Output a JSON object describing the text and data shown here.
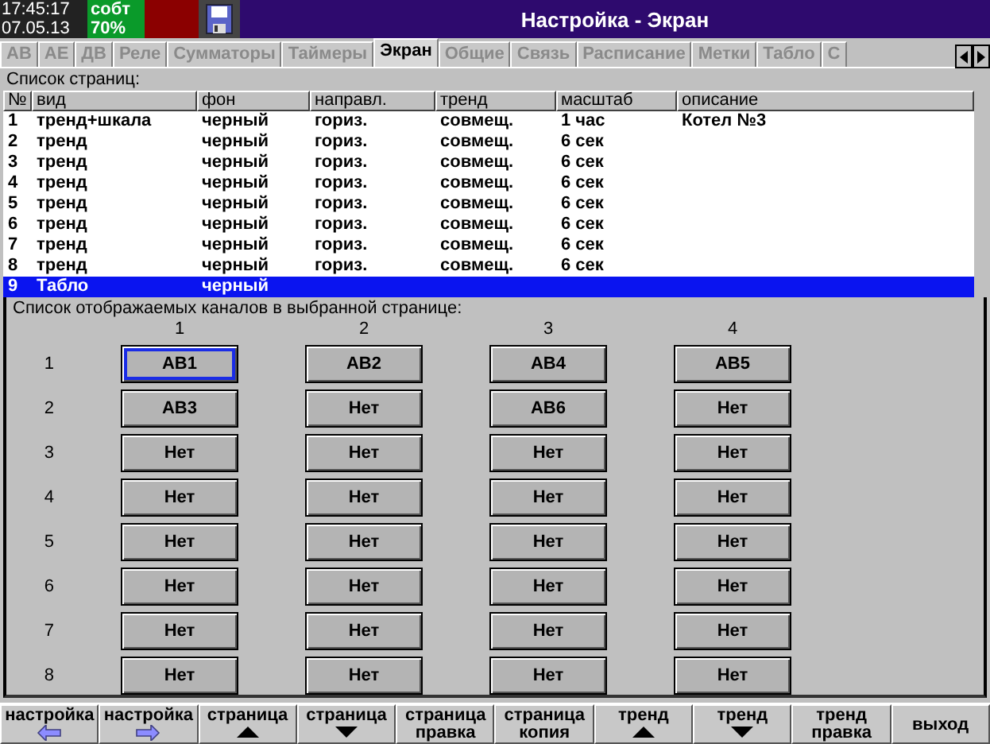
{
  "status": {
    "time": "17:45:17",
    "date": "07.05.13",
    "event": "собт",
    "percent": "70%"
  },
  "window": {
    "title": "Настройка - Экран"
  },
  "tabs": [
    {
      "label": "АВ",
      "selected": false
    },
    {
      "label": "АЕ",
      "selected": false
    },
    {
      "label": "ДВ",
      "selected": false
    },
    {
      "label": "Реле",
      "selected": false
    },
    {
      "label": "Сумматоры",
      "selected": false
    },
    {
      "label": "Таймеры",
      "selected": false
    },
    {
      "label": "Экран",
      "selected": true
    },
    {
      "label": "Общие",
      "selected": false
    },
    {
      "label": "Связь",
      "selected": false
    },
    {
      "label": "Расписание",
      "selected": false
    },
    {
      "label": "Метки",
      "selected": false
    },
    {
      "label": "Табло",
      "selected": false
    },
    {
      "label": "С",
      "selected": false
    }
  ],
  "pages": {
    "title": "Список страниц:",
    "columns": [
      "№",
      "вид",
      "фон",
      "направл.",
      "тренд",
      "масштаб",
      "описание"
    ],
    "rows": [
      {
        "cells": [
          "1",
          "тренд+шкала",
          "черный",
          "гориз.",
          "совмещ.",
          "1 час",
          "Котел №3"
        ],
        "selected": false
      },
      {
        "cells": [
          "2",
          "тренд",
          "черный",
          "гориз.",
          "совмещ.",
          "6 сек",
          ""
        ],
        "selected": false
      },
      {
        "cells": [
          "3",
          "тренд",
          "черный",
          "гориз.",
          "совмещ.",
          "6 сек",
          ""
        ],
        "selected": false
      },
      {
        "cells": [
          "4",
          "тренд",
          "черный",
          "гориз.",
          "совмещ.",
          "6 сек",
          ""
        ],
        "selected": false
      },
      {
        "cells": [
          "5",
          "тренд",
          "черный",
          "гориз.",
          "совмещ.",
          "6 сек",
          ""
        ],
        "selected": false
      },
      {
        "cells": [
          "6",
          "тренд",
          "черный",
          "гориз.",
          "совмещ.",
          "6 сек",
          ""
        ],
        "selected": false
      },
      {
        "cells": [
          "7",
          "тренд",
          "черный",
          "гориз.",
          "совмещ.",
          "6 сек",
          ""
        ],
        "selected": false
      },
      {
        "cells": [
          "8",
          "тренд",
          "черный",
          "гориз.",
          "совмещ.",
          "6 сек",
          ""
        ],
        "selected": false
      },
      {
        "cells": [
          "9",
          "Табло",
          "черный",
          "",
          "",
          "",
          ""
        ],
        "selected": true
      }
    ]
  },
  "channels": {
    "title": "Список отображаемых каналов в выбранной странице:",
    "columns": [
      "1",
      "2",
      "3",
      "4"
    ],
    "rows": [
      {
        "label": "1",
        "slots": [
          {
            "text": "АВ1",
            "selected": true
          },
          {
            "text": "АВ2",
            "selected": false
          },
          {
            "text": "АВ4",
            "selected": false
          },
          {
            "text": "АВ5",
            "selected": false
          }
        ]
      },
      {
        "label": "2",
        "slots": [
          {
            "text": "АВ3",
            "selected": false
          },
          {
            "text": "Нет",
            "selected": false
          },
          {
            "text": "АВ6",
            "selected": false
          },
          {
            "text": "Нет",
            "selected": false
          }
        ]
      },
      {
        "label": "3",
        "slots": [
          {
            "text": "Нет",
            "selected": false
          },
          {
            "text": "Нет",
            "selected": false
          },
          {
            "text": "Нет",
            "selected": false
          },
          {
            "text": "Нет",
            "selected": false
          }
        ]
      },
      {
        "label": "4",
        "slots": [
          {
            "text": "Нет",
            "selected": false
          },
          {
            "text": "Нет",
            "selected": false
          },
          {
            "text": "Нет",
            "selected": false
          },
          {
            "text": "Нет",
            "selected": false
          }
        ]
      },
      {
        "label": "5",
        "slots": [
          {
            "text": "Нет",
            "selected": false
          },
          {
            "text": "Нет",
            "selected": false
          },
          {
            "text": "Нет",
            "selected": false
          },
          {
            "text": "Нет",
            "selected": false
          }
        ]
      },
      {
        "label": "6",
        "slots": [
          {
            "text": "Нет",
            "selected": false
          },
          {
            "text": "Нет",
            "selected": false
          },
          {
            "text": "Нет",
            "selected": false
          },
          {
            "text": "Нет",
            "selected": false
          }
        ]
      },
      {
        "label": "7",
        "slots": [
          {
            "text": "Нет",
            "selected": false
          },
          {
            "text": "Нет",
            "selected": false
          },
          {
            "text": "Нет",
            "selected": false
          },
          {
            "text": "Нет",
            "selected": false
          }
        ]
      },
      {
        "label": "8",
        "slots": [
          {
            "text": "Нет",
            "selected": false
          },
          {
            "text": "Нет",
            "selected": false
          },
          {
            "text": "Нет",
            "selected": false
          },
          {
            "text": "Нет",
            "selected": false
          }
        ]
      }
    ]
  },
  "function_keys": [
    {
      "lines": [
        "настройка"
      ],
      "kind": "left"
    },
    {
      "lines": [
        "настройка"
      ],
      "kind": "right"
    },
    {
      "lines": [
        "страница"
      ],
      "kind": "up"
    },
    {
      "lines": [
        "страница"
      ],
      "kind": "down"
    },
    {
      "lines": [
        "страница",
        "правка"
      ],
      "kind": "text"
    },
    {
      "lines": [
        "страница",
        "копия"
      ],
      "kind": "text"
    },
    {
      "lines": [
        "тренд"
      ],
      "kind": "up"
    },
    {
      "lines": [
        "тренд"
      ],
      "kind": "down"
    },
    {
      "lines": [
        "тренд",
        "правка"
      ],
      "kind": "text"
    },
    {
      "lines": [
        "выход"
      ],
      "kind": "center"
    }
  ]
}
